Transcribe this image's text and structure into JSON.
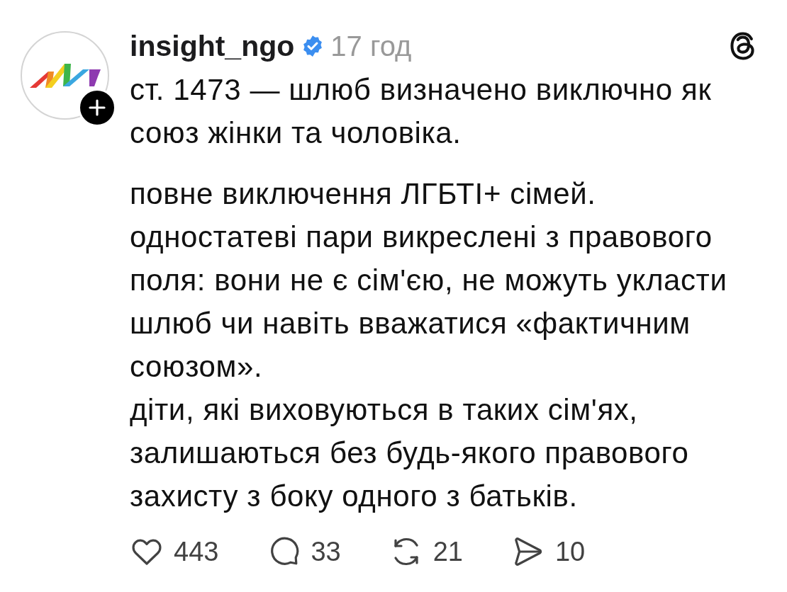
{
  "post": {
    "author": {
      "username": "insight_ngo",
      "verified": true,
      "time": "17 год"
    },
    "paragraphs": [
      {
        "lines": [
          "ст. 1473 — шлюб визначено виключно як союз жінки та чоловіка."
        ]
      },
      {
        "lines": [
          "повне виключення ЛГБТІ+ сімей.",
          "одностатеві пари викреслені з правового поля: вони не є сім'єю, не можуть укласти шлюб чи навіть вважатися «фактичним союзом».",
          "діти, які виховуються в таких сім'ях, залишаються без будь-якого правового захисту з боку одного з батьків."
        ]
      }
    ],
    "actions": [
      {
        "kind": "like",
        "count": "443"
      },
      {
        "kind": "reply",
        "count": "33"
      },
      {
        "kind": "repost",
        "count": "21"
      },
      {
        "kind": "share",
        "count": "10"
      }
    ]
  }
}
